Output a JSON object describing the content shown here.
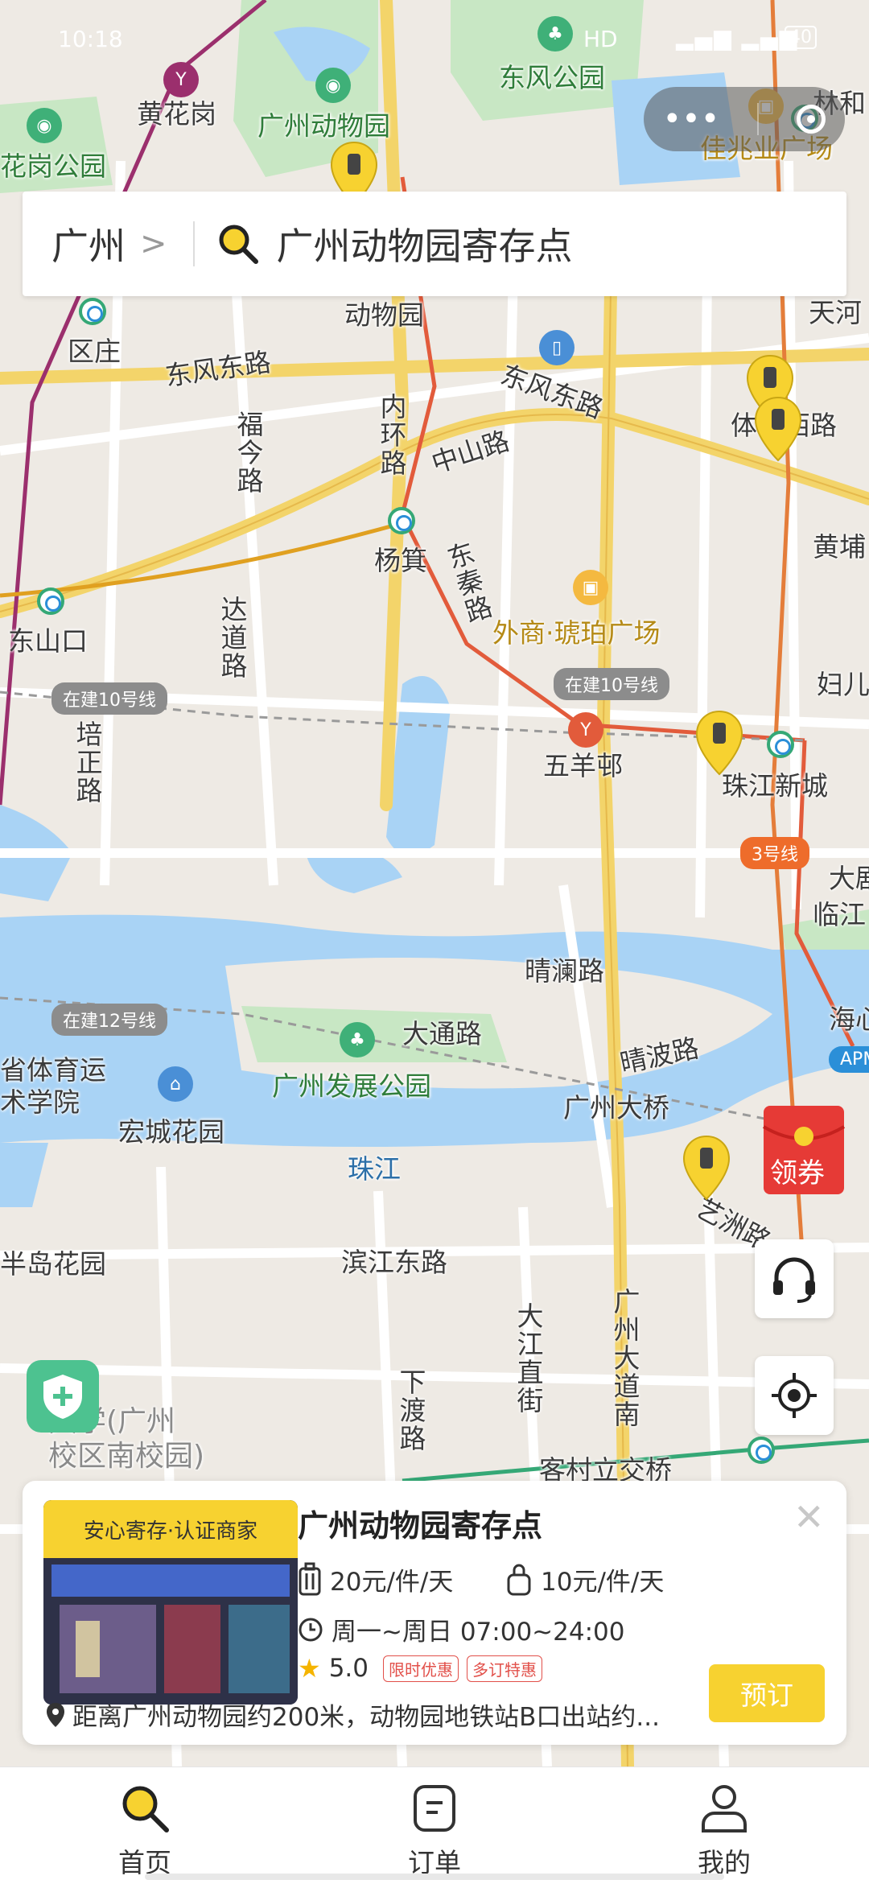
{
  "status_bar": {
    "time": "10:18",
    "network": "HD",
    "battery": "40"
  },
  "map": {
    "labels": {
      "huanghuagang": "黄花岗",
      "guangzhou_zoo": "广州动物园",
      "dongfeng_park": "东风公园",
      "linhe": "林和",
      "jiazhaoye": "佳兆业广场",
      "huagang_park": "花岗公园",
      "zoo_station": "动物园",
      "tianhe": "天河",
      "quzhuang": "区庄",
      "dongfeng_east_rd_w": "东风东路",
      "dongfeng_east_rd_e": "东风东路",
      "tiyu_west_rd": "体育西路",
      "funling_rd": "福今路",
      "inner_ring_rd": "内环路",
      "zhongshan_rd": "中山路",
      "yangji": "杨箕",
      "dongtai_rd": "东秦路",
      "huangpu": "黄埔",
      "dongshankou": "东山口",
      "dadao_rd": "达道路",
      "waishang_amber": "外商·琥珀广场",
      "funu": "妇儿",
      "wuyangyi": "五羊邨",
      "zhujiang_xincheng": "珠江新城",
      "peizheng_rd": "培正路",
      "daju": "大剧",
      "linjiang": "临江",
      "qinglan_rd": "晴澜路",
      "haixin": "海心",
      "datong_rd": "大通路",
      "qingbo_rd": "晴波路",
      "sports_art": "省体育运\n术学院",
      "development_park": "广州发展公园",
      "guangzhou_bridge": "广州大桥",
      "hongcheng_garden": "宏城花园",
      "pearl_river": "珠江",
      "yizhou_rd": "艺洲路",
      "bandao_garden": "半岛花园",
      "binjiang_east": "滨江东路",
      "dajiang_zhijie": "大江直街",
      "guangzhou_avenue_south": "广州大道南",
      "xiadu_rd": "下渡路",
      "university": "大学(广州\n校区南校园)",
      "kecun": "客村立交桥"
    },
    "pills": {
      "line10_w": "在建10号线",
      "line10_e": "在建10号线",
      "line12": "在建12号线",
      "line3": "3号线",
      "apm": "APM"
    },
    "colors": {
      "water": "#a9d3f5",
      "park": "#c8e7c4",
      "road_major": "#f3d46a",
      "metro_red": "#e25b3b",
      "metro_green": "#35a876"
    }
  },
  "search": {
    "city": "广州",
    "query": "广州动物园寄存点"
  },
  "coupon": {
    "label": "领券"
  },
  "card": {
    "tag": "安心寄存·认证商家",
    "title": "广州动物园寄存点",
    "price_large": "20元/件/天",
    "price_small": "10元/件/天",
    "hours": "周一~周日 07:00~24:00",
    "rating": "5.0",
    "badge1": "限时优惠",
    "badge2": "多订特惠",
    "address": "距离广州动物园约200米，动物园地铁站B口出站约...",
    "book": "预订"
  },
  "tabs": [
    {
      "label": "首页",
      "icon": "search-icon"
    },
    {
      "label": "订单",
      "icon": "order-icon"
    },
    {
      "label": "我的",
      "icon": "profile-icon"
    }
  ]
}
